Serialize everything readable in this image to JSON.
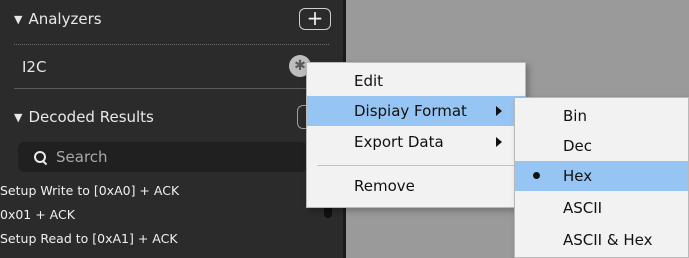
{
  "analyzers": {
    "header": "Analyzers",
    "add_button": "+",
    "items": [
      "I2C"
    ],
    "settings_icon": "gear-icon"
  },
  "decoded_results": {
    "header": "Decoded Results",
    "search_placeholder": "Search",
    "search_icon": "search-icon",
    "rows": [
      "Setup Write to [0xA0] + ACK",
      "0x01 + ACK",
      "Setup Read to [0xA1] + ACK"
    ]
  },
  "context_menu": {
    "items": [
      "Edit",
      "Dispiay Format",
      "Export Data",
      "Remove"
    ]
  },
  "format_submenu": {
    "items": [
      "Bin",
      "Dec",
      "Hex",
      "ASCII",
      "ASCII & Hex"
    ],
    "selected": "Hex"
  },
  "colors": {
    "panel_bg": "#2b2b2b",
    "menu_bg": "#f2f2f2",
    "highlight": "#97c5f3",
    "canvas_bg": "#9a9a9a"
  }
}
